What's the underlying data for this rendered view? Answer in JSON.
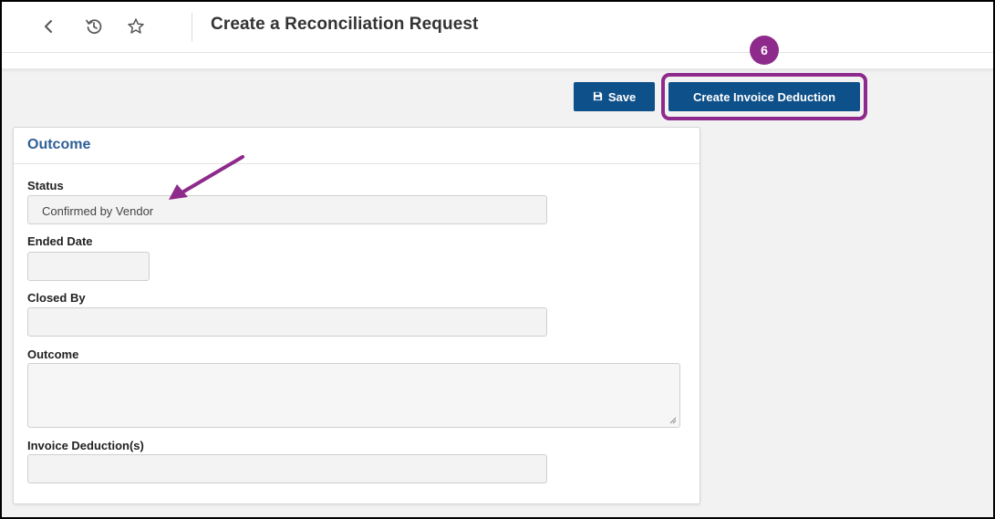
{
  "header": {
    "title": "Create a Reconciliation Request",
    "icons": [
      "back-icon",
      "history-icon",
      "star-icon"
    ]
  },
  "toolbar": {
    "save_label": "Save",
    "create_invoice_deduction_label": "Create Invoice Deduction"
  },
  "annotation": {
    "step_number": "6",
    "accent_color": "#8e2a8b"
  },
  "outcome_panel": {
    "title": "Outcome",
    "fields": {
      "status": {
        "label": "Status",
        "value": "Confirmed by Vendor"
      },
      "ended_date": {
        "label": "Ended Date",
        "value": ""
      },
      "closed_by": {
        "label": "Closed By",
        "value": ""
      },
      "outcome": {
        "label": "Outcome",
        "value": ""
      },
      "invoice_deductions": {
        "label": "Invoice Deduction(s)",
        "value": ""
      }
    }
  },
  "colors": {
    "primary_button": "#0e5089",
    "panel_title": "#2f6096"
  }
}
